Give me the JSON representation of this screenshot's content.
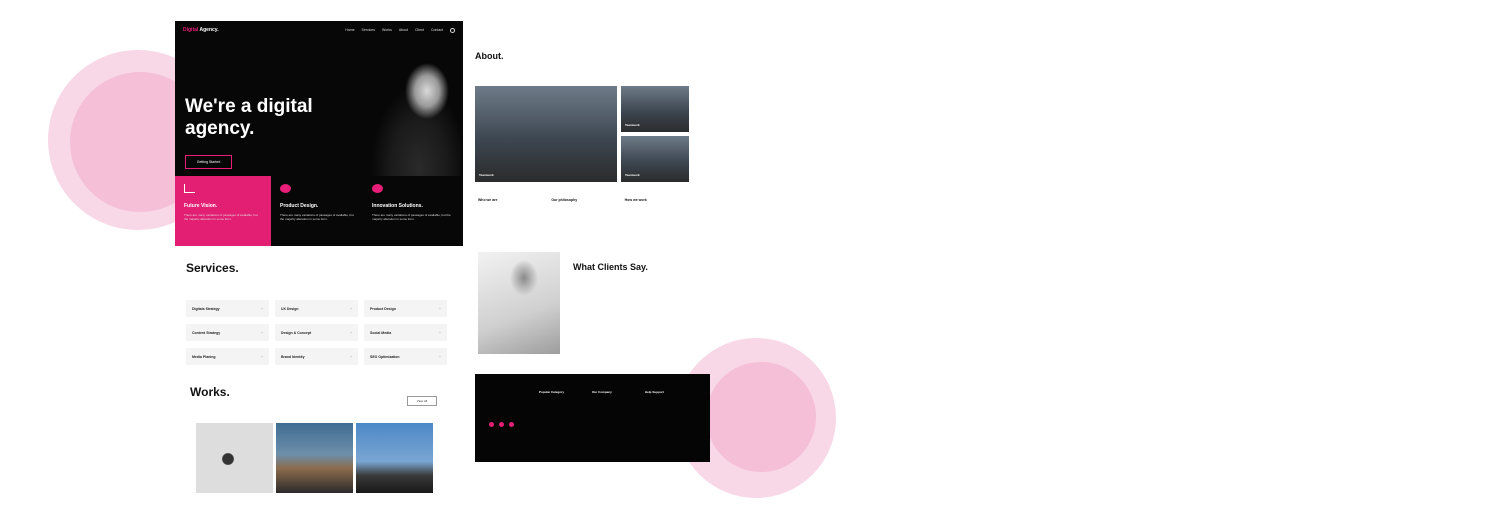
{
  "hero": {
    "brand_main": "Digital",
    "brand_tail": "Agency.",
    "nav": [
      "Home",
      "Services",
      "Works",
      "About",
      "Client",
      "Contact"
    ],
    "title": "We're a digital agency.",
    "cta": "Getting Started"
  },
  "features": [
    {
      "title": "Future Vision.",
      "text": "There are many variations of passages of available, but the majority alteration in some form."
    },
    {
      "title": "Product Design.",
      "text": "There are many variations of passages of available, but the majority alteration in some form."
    },
    {
      "title": "Innovation Solutions.",
      "text": "There are many variations of passages of available, but the majority alteration in some form."
    }
  ],
  "services": {
    "title": "Services.",
    "items": [
      "Digitals Strategy",
      "UX Design",
      "Product Design",
      "Content Strategy",
      "Design & Concept",
      "Social Media",
      "Media Planing",
      "Brand Identity",
      "SEO Optimization"
    ]
  },
  "works": {
    "title": "Works.",
    "view_all": "View All"
  },
  "about": {
    "title": "About.",
    "photos": [
      "Teamwork",
      "Teamwork",
      "Teamwork"
    ],
    "columns": [
      "Who we are",
      "Our philosophy",
      "How we work"
    ]
  },
  "clients": {
    "title": "What Clients Say."
  },
  "footer": {
    "columns": [
      {
        "title": "Popular Category"
      },
      {
        "title": "Our Company"
      },
      {
        "title": "Help Support"
      }
    ]
  }
}
